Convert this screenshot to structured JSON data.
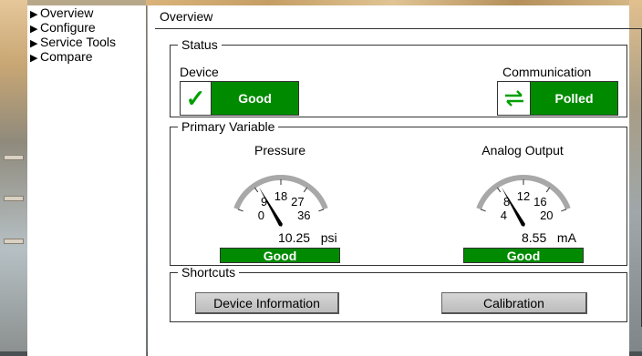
{
  "nav": {
    "items": [
      {
        "label": "Overview"
      },
      {
        "label": "Configure"
      },
      {
        "label": "Service Tools"
      },
      {
        "label": "Compare"
      }
    ]
  },
  "main": {
    "title": "Overview"
  },
  "status": {
    "legend": "Status",
    "device": {
      "label": "Device",
      "value": "Good",
      "icon": "checkmark-icon",
      "color": "#008a00"
    },
    "communication": {
      "label": "Communication",
      "value": "Polled",
      "icon": "exchange-arrows-icon",
      "color": "#008a00"
    }
  },
  "primary_variable": {
    "legend": "Primary Variable",
    "gauges": [
      {
        "title": "Pressure",
        "min": 0,
        "max": 36,
        "ticks": [
          "0",
          "9",
          "18",
          "27",
          "36"
        ],
        "value": 10.25,
        "value_text": "10.25",
        "unit": "psi",
        "status": "Good"
      },
      {
        "title": "Analog Output",
        "min": 4,
        "max": 20,
        "ticks": [
          "4",
          "8",
          "12",
          "16",
          "20"
        ],
        "value": 8.55,
        "value_text": "8.55",
        "unit": "mA",
        "status": "Good"
      }
    ]
  },
  "shortcuts": {
    "legend": "Shortcuts",
    "device_info_label": "Device Information",
    "calibration_label": "Calibration"
  },
  "colors": {
    "good": "#008a00",
    "gauge_arc": "#a8a8a8",
    "check": "#00a000"
  }
}
